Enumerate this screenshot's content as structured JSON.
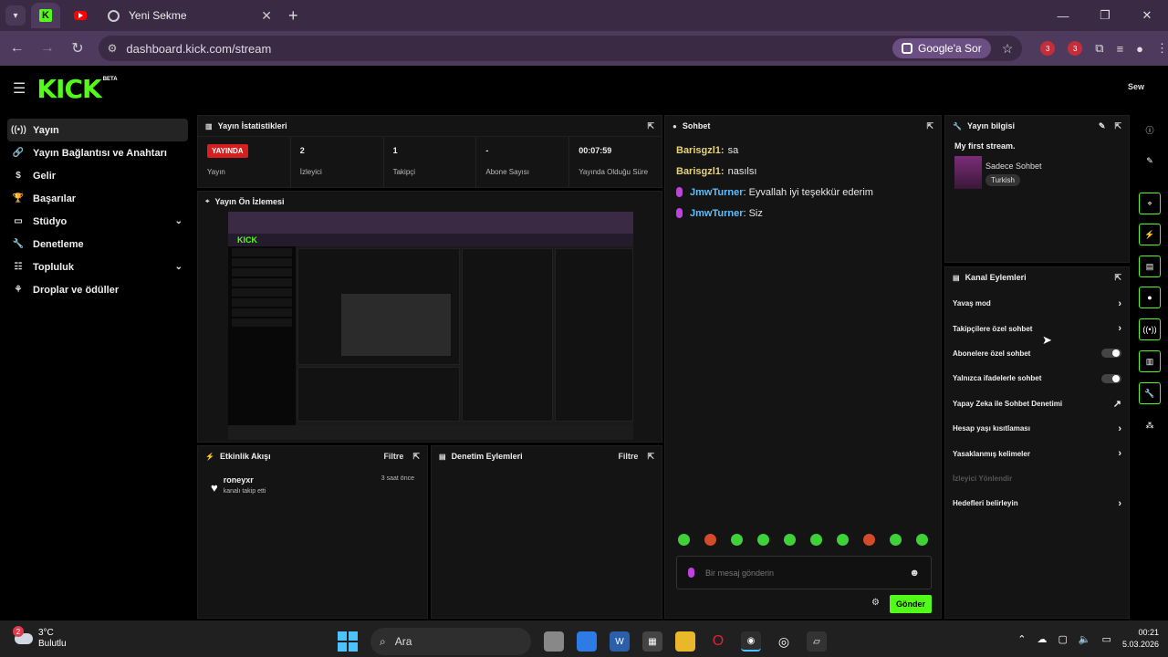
{
  "browser": {
    "tab_title": "Yeni Sekme",
    "url": "dashboard.kick.com/stream",
    "ask_button": "Google'a Sor",
    "ext_badge_1": "3",
    "ext_badge_2": "3"
  },
  "header": {
    "logo": "KICK",
    "beta": "BETA",
    "avatar_text": "Sew"
  },
  "sidebar": {
    "items": [
      {
        "label": "Yayın",
        "icon": "broadcast-icon"
      },
      {
        "label": "Yayın Bağlantısı ve Anahtarı",
        "icon": "link-icon"
      },
      {
        "label": "Gelir",
        "icon": "dollar-icon"
      },
      {
        "label": "Başarılar",
        "icon": "trophy-icon"
      },
      {
        "label": "Stüdyo",
        "icon": "studio-icon"
      },
      {
        "label": "Denetleme",
        "icon": "wrench-icon"
      },
      {
        "label": "Topluluk",
        "icon": "community-icon"
      },
      {
        "label": "Droplar ve ödüller",
        "icon": "gift-icon"
      }
    ]
  },
  "stats_panel": {
    "title": "Yayın İstatistikleri",
    "live_label": "YAYINDA",
    "status_label": "Yayın",
    "viewers_value": "2",
    "viewers_label": "İzleyici",
    "followers_value": "1",
    "followers_label": "Takipçi",
    "subs_value": "-",
    "subs_label": "Abone Sayısı",
    "duration_value": "00:07:59",
    "duration_label": "Yayında Olduğu Süre"
  },
  "preview_panel": {
    "title": "Yayın Ön İzlemesi"
  },
  "activity_panel": {
    "title": "Etkinlik Akışı",
    "filter": "Filtre",
    "events": [
      {
        "user": "roneyxr",
        "text": "kanalı takip etti",
        "time": "3 saat önce"
      }
    ]
  },
  "mod_panel": {
    "title": "Denetim Eylemleri",
    "filter": "Filtre"
  },
  "chat_panel": {
    "title": "Sohbet",
    "messages": [
      {
        "user": "Barisgzl1:",
        "text": "sa"
      },
      {
        "user": "Barisgzl1:",
        "text": "nasılsı"
      },
      {
        "user": "JmwTurner",
        "text": ": Eyvallah iyi teşekkür ederim"
      },
      {
        "user": "JmwTurner",
        "text": ": Siz"
      }
    ],
    "placeholder": "Bir mesaj gönderin",
    "send": "Gönder"
  },
  "stream_info": {
    "title": "Yayın bilgisi",
    "stream_title": "My first stream.",
    "category": "Sadece Sohbet",
    "language": "Turkish"
  },
  "channel_actions": {
    "title": "Kanal Eylemleri",
    "items": [
      {
        "label": "Yavaş mod",
        "control": "arrow"
      },
      {
        "label": "Takipçilere özel sohbet",
        "control": "arrow"
      },
      {
        "label": "Abonelere özel sohbet",
        "control": "toggle"
      },
      {
        "label": "Yalnızca ifadelerle sohbet",
        "control": "toggle"
      },
      {
        "label": "Yapay Zeka ile Sohbet Denetimi",
        "control": "external"
      },
      {
        "label": "Hesap yaşı kısıtlaması",
        "control": "arrow"
      },
      {
        "label": "Yasaklanmış kelimeler",
        "control": "arrow"
      },
      {
        "label": "İzleyici Yönlendir",
        "control": "none"
      },
      {
        "label": "Hedefleri belirleyin",
        "control": "arrow"
      }
    ]
  },
  "taskbar": {
    "weather_badge": "2",
    "temperature": "3°C",
    "condition": "Bulutlu",
    "search": "Ara",
    "time": "00:21",
    "date": "5.03.2026"
  },
  "colors": {
    "accent": "#53fc18",
    "live": "#d62020",
    "chat_user": "#e6d27a",
    "chat_user_blue": "#5ac0ff"
  }
}
